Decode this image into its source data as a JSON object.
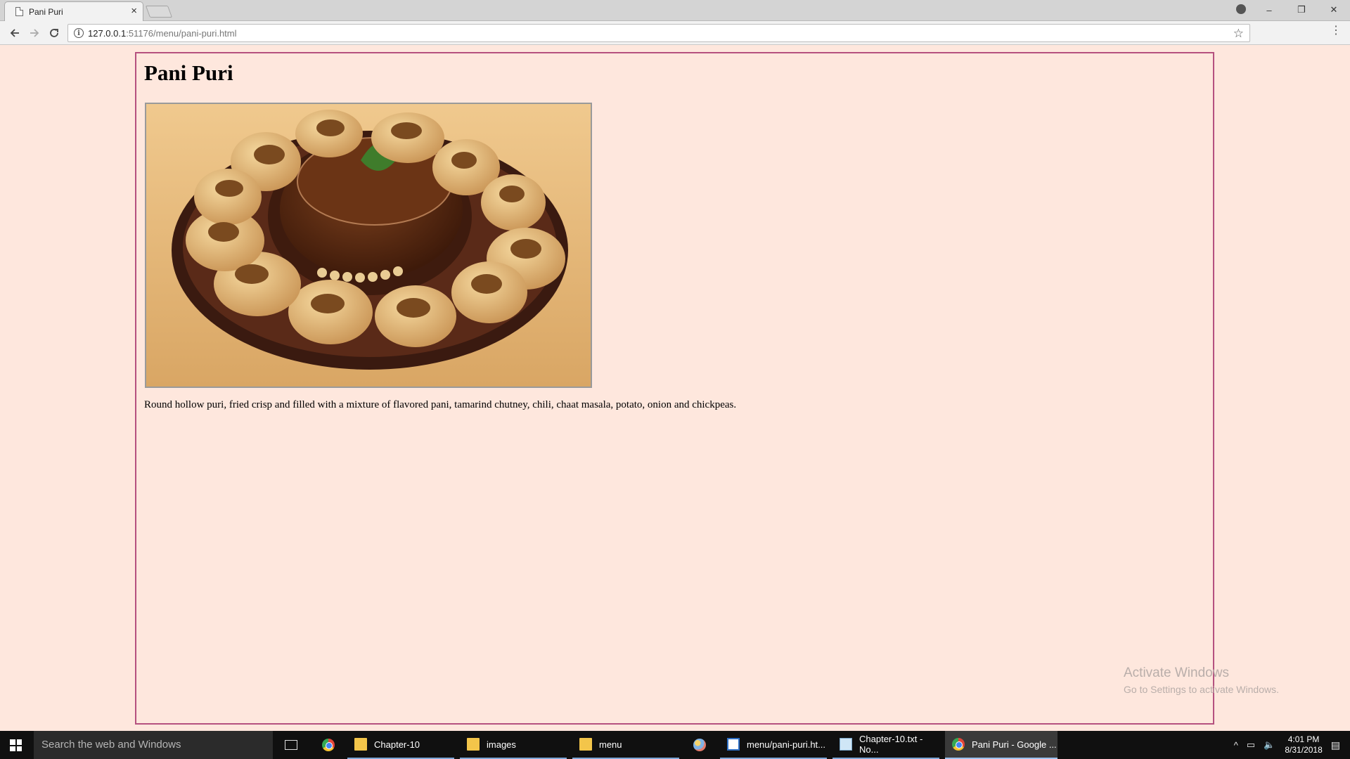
{
  "browser": {
    "tab_title": "Pani Puri",
    "tab_close": "×",
    "url_host": "127.0.0.1",
    "url_rest": ":51176/menu/pani-puri.html",
    "win_minimize": "–",
    "win_restore": "❐",
    "win_close": "✕"
  },
  "page": {
    "title": "Pani Puri",
    "description": "Round hollow puri, fried crisp and filled with a mixture of flavored pani, tamarind chutney, chili, chaat masala, potato, onion and chickpeas.",
    "border_color": "#b5517f",
    "background_color": "#fee7dd"
  },
  "watermark": {
    "title": "Activate Windows",
    "subtitle": "Go to Settings to activate Windows."
  },
  "taskbar": {
    "search_placeholder": "Search the web and Windows",
    "items": [
      {
        "label": "Chapter-10"
      },
      {
        "label": "images"
      },
      {
        "label": "menu"
      },
      {
        "label": "menu/pani-puri.ht..."
      },
      {
        "label": "Chapter-10.txt - No..."
      },
      {
        "label": "Pani Puri - Google ..."
      }
    ],
    "time": "4:01 PM",
    "date": "8/31/2018"
  }
}
